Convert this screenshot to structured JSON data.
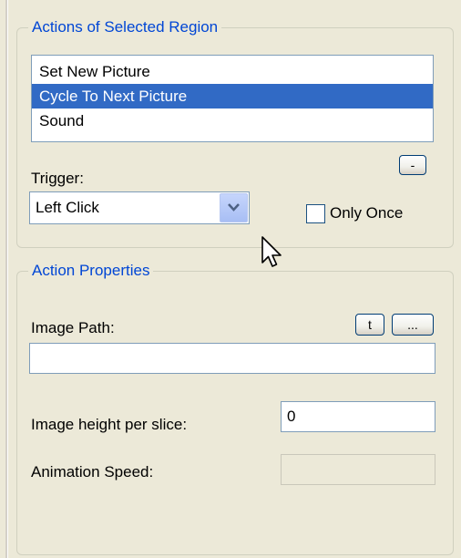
{
  "actions_group": {
    "title": "Actions of Selected Region",
    "items": [
      {
        "label": "Set New Picture",
        "selected": false
      },
      {
        "label": "Cycle To Next Picture",
        "selected": true
      },
      {
        "label": "Sound",
        "selected": false
      }
    ],
    "remove_button_label": "-",
    "trigger_label": "Trigger:",
    "trigger_value": "Left Click",
    "only_once_label": "Only Once",
    "only_once_checked": false
  },
  "properties_group": {
    "title": "Action Properties",
    "image_path_label": "Image Path:",
    "t_button_label": "t",
    "browse_button_label": "...",
    "image_path_value": "",
    "height_label": "Image height per slice:",
    "height_value": "0",
    "speed_label": "Animation Speed:",
    "speed_value": ""
  },
  "icons": {
    "dropdown": "chevron-down-icon",
    "pointer": "mouse-pointer-icon"
  },
  "colors": {
    "background": "#ece9d8",
    "legend_text": "#0046d5",
    "selection": "#316ac5"
  }
}
